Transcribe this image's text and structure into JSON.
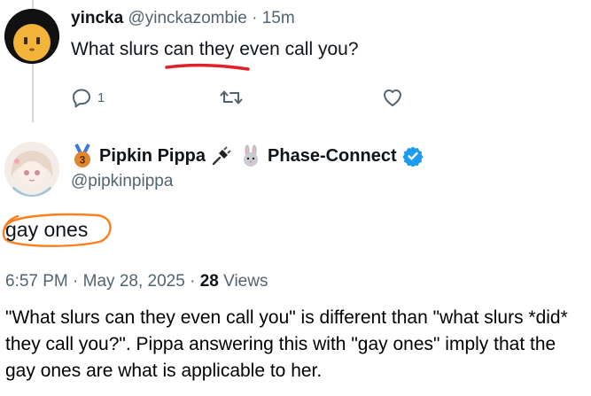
{
  "reply_tweet": {
    "display_name": "yincka",
    "handle": "@yinckazombie",
    "separator": "·",
    "time": "15m",
    "text": "What slurs can they even call you?",
    "reply_count": "1",
    "icons": [
      "reply-icon",
      "retweet-icon",
      "like-icon"
    ]
  },
  "answer_tweet": {
    "display_name": "Pipkin Pippa",
    "badge_rank": "3",
    "affiliation": "Phase-Connect",
    "handle": "@pipkinpippa",
    "text": "gay ones",
    "time": "6:57 PM",
    "date": "May 28, 2025",
    "separator": "·",
    "views_count": "28",
    "views_label": "Views",
    "icons": [
      "medal-icon",
      "plug-icon",
      "rabbit-icon",
      "verified-icon"
    ]
  },
  "annotations": {
    "underline_color": "#e0202a",
    "circle_color": "#ff7f1e"
  },
  "commentary": "\"What slurs can they even call you\" is different than \"what slurs *did* they call you?\". Pippa answering this with \"gay ones\" imply that the gay ones are what is applicable to her.",
  "colors": {
    "text": "#0f1419",
    "muted": "#536471",
    "verified": "#1d9bf0",
    "thread_line": "#cfd9de"
  }
}
